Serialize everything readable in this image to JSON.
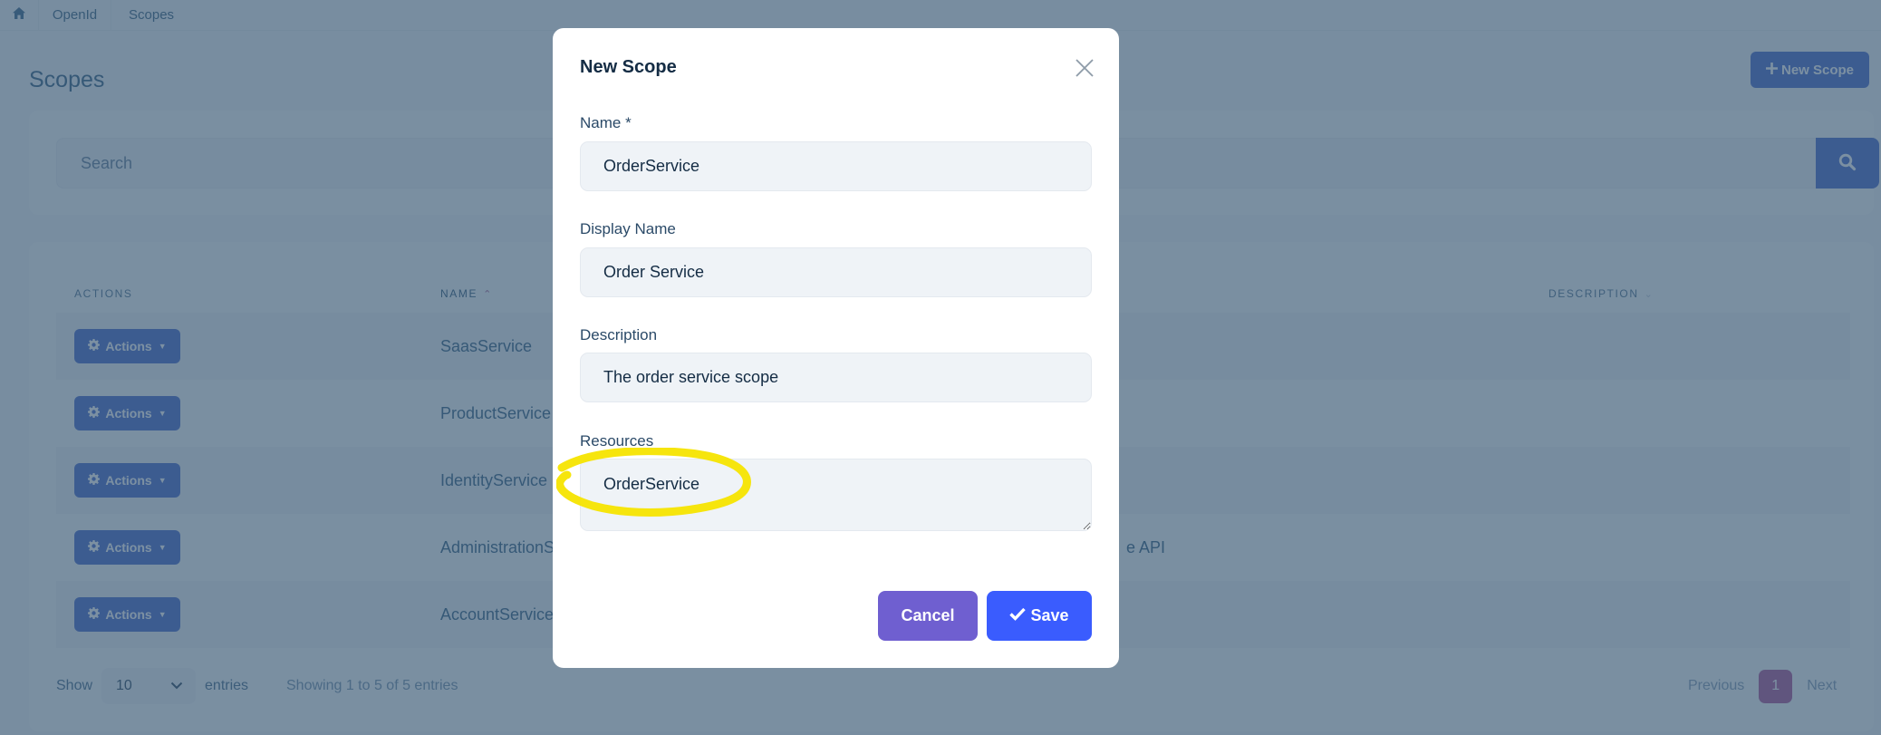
{
  "breadcrumb": {
    "home_icon": "home-icon",
    "items": [
      "OpenId",
      "Scopes"
    ]
  },
  "page": {
    "title": "Scopes",
    "new_button_label": "New Scope",
    "new_button_icon": "plus-icon"
  },
  "search": {
    "placeholder": "Search",
    "value": "",
    "button_icon": "search-icon"
  },
  "table": {
    "headers": {
      "actions": "Actions",
      "name": "Name",
      "description": "Description"
    },
    "sort": {
      "column": "name",
      "direction": "asc"
    },
    "rows": [
      {
        "action_label": "Actions",
        "name": "SaasService",
        "display_name": ""
      },
      {
        "action_label": "Actions",
        "name": "ProductService",
        "display_name": ""
      },
      {
        "action_label": "Actions",
        "name": "IdentityService",
        "display_name": ""
      },
      {
        "action_label": "Actions",
        "name": "AdministrationS",
        "display_name": "e API"
      },
      {
        "action_label": "Actions",
        "name": "AccountService",
        "display_name": ""
      }
    ],
    "footer": {
      "show_label": "Show",
      "page_size": "10",
      "entries_label": "entries",
      "showing_text": "Showing 1 to 5 of 5 entries",
      "previous_label": "Previous",
      "current_page": "1",
      "next_label": "Next"
    }
  },
  "modal": {
    "title": "New Scope",
    "close_icon": "close-icon",
    "fields": {
      "name": {
        "label": "Name *",
        "value": "OrderService"
      },
      "display_name": {
        "label": "Display Name",
        "value": "Order Service"
      },
      "description": {
        "label": "Description",
        "value": "The order service scope"
      },
      "resources": {
        "label": "Resources",
        "value": "OrderService"
      }
    },
    "cancel_label": "Cancel",
    "save_label": "Save",
    "save_icon": "check-icon"
  },
  "colors": {
    "primary": "#3a5cfe",
    "cancel": "#6f5fd0",
    "page_active": "#a8488f",
    "highlight": "#f5e400"
  }
}
